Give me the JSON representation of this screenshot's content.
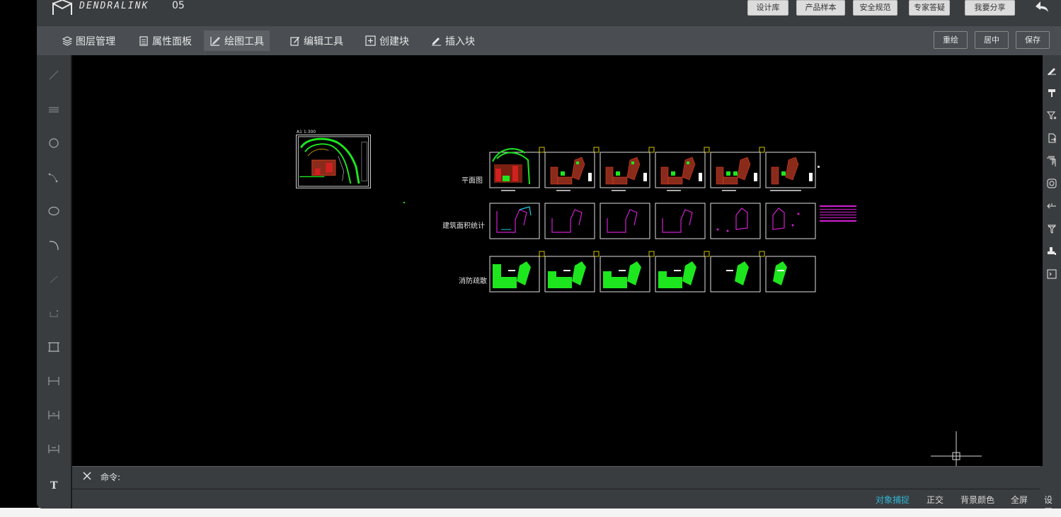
{
  "header": {
    "brand": "DENDRALINK",
    "project_name": "05",
    "buttons": [
      "设计库",
      "产品样本",
      "安全规范",
      "专家答疑",
      "我要分享"
    ]
  },
  "menu": {
    "items": [
      {
        "label": "图层管理",
        "icon": "layers-icon"
      },
      {
        "label": "属性面板",
        "icon": "panel-icon"
      },
      {
        "label": "绘图工具",
        "icon": "draw-icon",
        "active": true
      },
      {
        "label": "编辑工具",
        "icon": "edit-icon"
      },
      {
        "label": "创建块",
        "icon": "create-block-icon"
      },
      {
        "label": "插入块",
        "icon": "insert-block-icon"
      }
    ],
    "right_buttons": [
      "重绘",
      "居中",
      "保存"
    ]
  },
  "left_tools": [
    "line-icon",
    "multiline-icon",
    "circle-icon",
    "polyline-icon",
    "ellipse-icon",
    "arc-icon",
    "ray-icon",
    "rectangle-corner-icon",
    "rectangle-icon",
    "dimension-icon",
    "dimension-aligned-icon",
    "dimension-angular-icon",
    "text-icon"
  ],
  "right_tools": [
    "pen-icon",
    "paint-roller-icon",
    "filter-icon",
    "export-icon",
    "layer-stack-icon",
    "rotate-icon",
    "move-icon",
    "funnel-icon",
    "paint-icon",
    "terminal-icon"
  ],
  "drawing": {
    "rows": [
      "平面图",
      "建筑面积统计",
      "消防疏散"
    ],
    "overview_title": "A1 1:300"
  },
  "command": {
    "label": "命令:",
    "value": ""
  },
  "status": {
    "items": [
      {
        "label": "对象捕捉",
        "on": true
      },
      {
        "label": "正交",
        "on": false
      },
      {
        "label": "背景颜色",
        "on": false
      },
      {
        "label": "全屏",
        "on": false
      },
      {
        "label": "设置",
        "on": false
      }
    ]
  },
  "colors": {
    "accent": "#2eb5d6",
    "drawing_green": "#1ee61e",
    "drawing_magenta": "#d020d0",
    "drawing_red": "#c03020",
    "sheet_tab": "#d4c200"
  }
}
